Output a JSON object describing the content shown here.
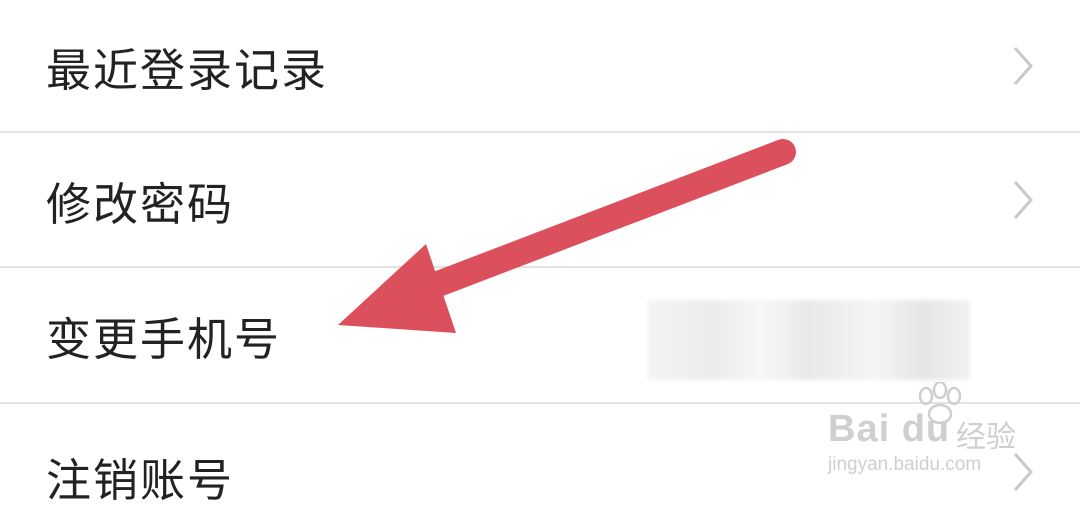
{
  "menu": {
    "items": [
      {
        "label": "最近登录记录",
        "icon": "chevron-right-icon"
      },
      {
        "label": "修改密码",
        "icon": "chevron-right-icon"
      },
      {
        "label": "变更手机号",
        "icon": "chevron-right-icon"
      },
      {
        "label": "注销账号",
        "icon": "chevron-right-icon"
      }
    ]
  },
  "watermark": {
    "logo": "Bai du",
    "cn": "经验",
    "url": "jingyan.baidu.com"
  },
  "colors": {
    "arrow": "#dc4f5c",
    "text": "#222222",
    "divider": "#e3e3e3",
    "chevron": "#c8c8c8"
  }
}
